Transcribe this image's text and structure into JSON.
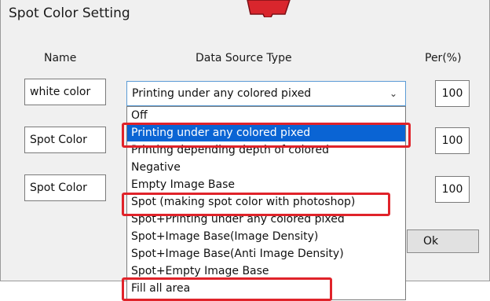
{
  "window": {
    "title": "Spot Color Setting"
  },
  "columns": {
    "name": "Name",
    "source": "Data Source Type",
    "per": "Per(%)"
  },
  "rows": [
    {
      "name": "white color",
      "per": "100"
    },
    {
      "name": "Spot Color",
      "per": "100"
    },
    {
      "name": "Spot Color",
      "per": "100"
    }
  ],
  "combo": {
    "value": "Printing under any colored pixed"
  },
  "dropdown": {
    "options": [
      "Off",
      "Printing under any colored pixed",
      "Printing depending depth of colored",
      "Negative",
      "Empty Image Base",
      "Spot (making spot color with photoshop)",
      "Spot+Printing under any colored pixed",
      "Spot+Image Base(Image Density)",
      "Spot+Image Base(Anti Image Density)",
      "Spot+Empty Image Base",
      "Fill all area"
    ],
    "selected_index": 1
  },
  "buttons": {
    "ok": "Ok"
  },
  "colors": {
    "highlight": "#e0232a",
    "selection": "#0a64d4"
  }
}
